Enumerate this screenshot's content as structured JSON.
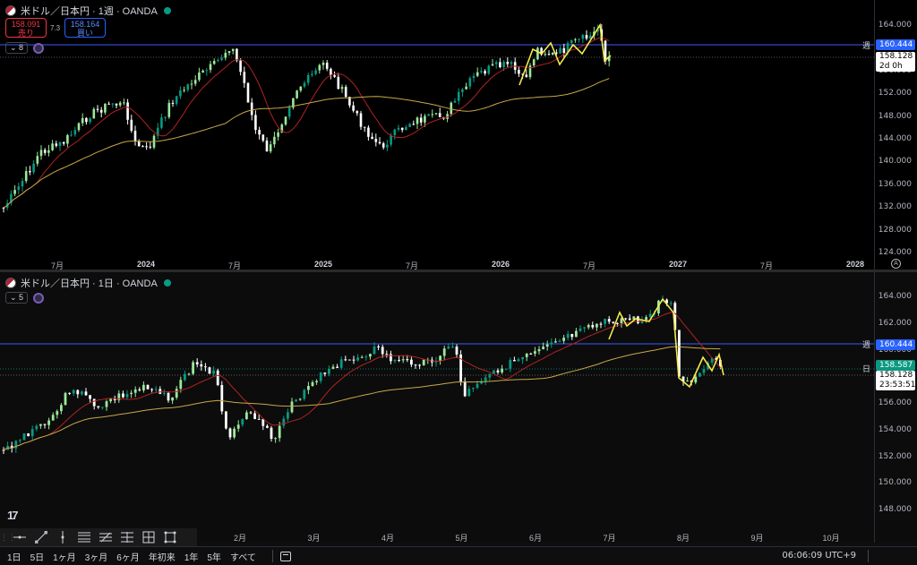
{
  "top_chart": {
    "title": "米ドル／日本円 · 1週 · OANDA",
    "sell_price": "158.091",
    "sell_label": "売り",
    "buy_price": "158.164",
    "buy_label": "買い",
    "spread": "7.3",
    "indicator_count": "8",
    "price_ticks": [
      "164.000",
      "160.000",
      "156.000",
      "152.000",
      "148.000",
      "144.000",
      "140.000",
      "136.000",
      "132.000",
      "128.000",
      "124.000"
    ],
    "price_tick_values": [
      164,
      160,
      156,
      152,
      148,
      144,
      140,
      136,
      132,
      128,
      124
    ],
    "time_ticks": [
      {
        "label": "7月",
        "bold": false
      },
      {
        "label": "2024",
        "bold": true
      },
      {
        "label": "7月",
        "bold": false
      },
      {
        "label": "2025",
        "bold": true
      },
      {
        "label": "7月",
        "bold": false
      },
      {
        "label": "2026",
        "bold": true
      },
      {
        "label": "7月",
        "bold": false
      },
      {
        "label": "2027",
        "bold": true
      },
      {
        "label": "7月",
        "bold": false
      },
      {
        "label": "2028",
        "bold": true
      }
    ],
    "hline_tag": "週",
    "hline_price": "160.444",
    "last_price": "158.128",
    "countdown": "2d 0h",
    "settings_icon": "A"
  },
  "bottom_chart": {
    "title": "米ドル／日本円 · 1日 · OANDA",
    "indicator_count": "5",
    "price_ticks": [
      "164.000",
      "162.000",
      "160.000",
      "158.000",
      "156.000",
      "154.000",
      "152.000",
      "150.000",
      "148.000"
    ],
    "price_tick_values": [
      164,
      162,
      160,
      158,
      156,
      154,
      152,
      150,
      148
    ],
    "time_ticks": [
      {
        "label": "2月",
        "bold": false
      },
      {
        "label": "3月",
        "bold": false
      },
      {
        "label": "4月",
        "bold": false
      },
      {
        "label": "5月",
        "bold": false
      },
      {
        "label": "6月",
        "bold": false
      },
      {
        "label": "7月",
        "bold": false
      },
      {
        "label": "8月",
        "bold": false
      },
      {
        "label": "9月",
        "bold": false
      },
      {
        "label": "10月",
        "bold": false
      }
    ],
    "hline_tag": "週",
    "hline_price": "160.444",
    "day_tag": "日",
    "day_price": "158.587",
    "last_price": "158.128",
    "countdown": "23:53:51"
  },
  "logo_text": "17",
  "range_buttons": [
    "1日",
    "5日",
    "1ヶ月",
    "3ヶ月",
    "6ヶ月",
    "年初来",
    "1年",
    "5年",
    "すべて"
  ],
  "clock": "06:06:09 UTC+9",
  "colors": {
    "up": "#089981",
    "up_light": "#9be89b",
    "down": "#ffffff",
    "ma_red": "#b22222",
    "ma_yellow": "#c8a84a",
    "zigzag": "#f5e94b",
    "hline": "#3d5afe",
    "grid_dot": "#777777"
  },
  "drawing_tools": [
    "horizontal-line-icon",
    "trend-line-icon",
    "vertical-line-icon",
    "fib-retracement-icon",
    "pitchfork-icon",
    "gann-icon",
    "rectangle-tool-icon",
    "frame-icon"
  ]
}
